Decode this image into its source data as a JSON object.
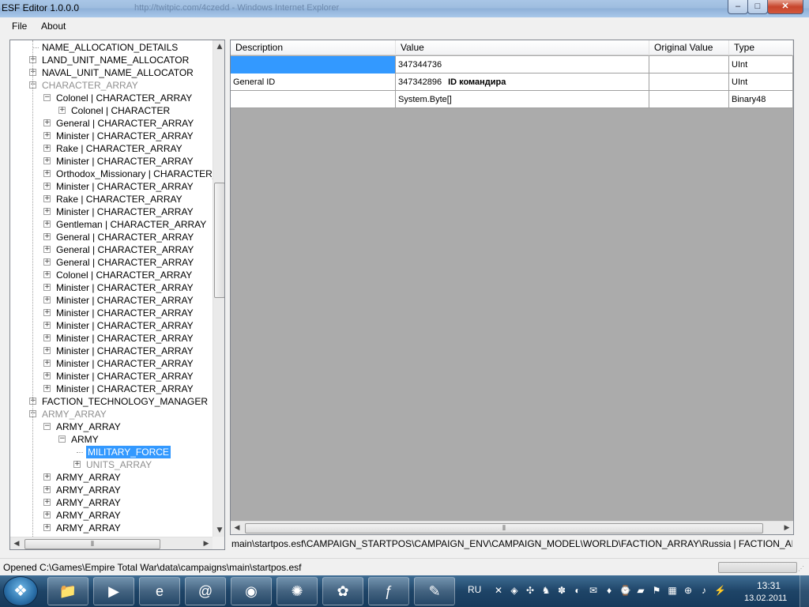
{
  "window": {
    "title": "ESF Editor 1.0.0.0",
    "ghost_title": "http://twitpic.com/4czedd - Windows Internet Explorer",
    "caption_buttons": {
      "minimize": "–",
      "maximize": "□",
      "close": "✕"
    }
  },
  "menu": {
    "file": "File",
    "about": "About"
  },
  "tree": {
    "nodes": [
      {
        "label": "NAME_ALLOCATION_DETAILS",
        "level": 0,
        "expander": "none",
        "gray": false
      },
      {
        "label": "LAND_UNIT_NAME_ALLOCATOR",
        "level": 0,
        "expander": "plus",
        "gray": false
      },
      {
        "label": "NAVAL_UNIT_NAME_ALLOCATOR",
        "level": 0,
        "expander": "plus",
        "gray": false
      },
      {
        "label": "CHARACTER_ARRAY",
        "level": 0,
        "expander": "minus",
        "gray": true
      },
      {
        "label": "Colonel | CHARACTER_ARRAY",
        "level": 1,
        "expander": "minus",
        "gray": false
      },
      {
        "label": "Colonel | CHARACTER",
        "level": 2,
        "expander": "plus",
        "gray": false
      },
      {
        "label": "General | CHARACTER_ARRAY",
        "level": 1,
        "expander": "plus",
        "gray": false
      },
      {
        "label": "Minister | CHARACTER_ARRAY",
        "level": 1,
        "expander": "plus",
        "gray": false
      },
      {
        "label": "Rake | CHARACTER_ARRAY",
        "level": 1,
        "expander": "plus",
        "gray": false
      },
      {
        "label": "Minister | CHARACTER_ARRAY",
        "level": 1,
        "expander": "plus",
        "gray": false
      },
      {
        "label": "Orthodox_Missionary | CHARACTER_ARR",
        "level": 1,
        "expander": "plus",
        "gray": false
      },
      {
        "label": "Minister | CHARACTER_ARRAY",
        "level": 1,
        "expander": "plus",
        "gray": false
      },
      {
        "label": "Rake | CHARACTER_ARRAY",
        "level": 1,
        "expander": "plus",
        "gray": false
      },
      {
        "label": "Minister | CHARACTER_ARRAY",
        "level": 1,
        "expander": "plus",
        "gray": false
      },
      {
        "label": "Gentleman | CHARACTER_ARRAY",
        "level": 1,
        "expander": "plus",
        "gray": false
      },
      {
        "label": "General | CHARACTER_ARRAY",
        "level": 1,
        "expander": "plus",
        "gray": false
      },
      {
        "label": "General | CHARACTER_ARRAY",
        "level": 1,
        "expander": "plus",
        "gray": false
      },
      {
        "label": "General | CHARACTER_ARRAY",
        "level": 1,
        "expander": "plus",
        "gray": false
      },
      {
        "label": "Colonel | CHARACTER_ARRAY",
        "level": 1,
        "expander": "plus",
        "gray": false
      },
      {
        "label": "Minister | CHARACTER_ARRAY",
        "level": 1,
        "expander": "plus",
        "gray": false
      },
      {
        "label": "Minister | CHARACTER_ARRAY",
        "level": 1,
        "expander": "plus",
        "gray": false
      },
      {
        "label": "Minister | CHARACTER_ARRAY",
        "level": 1,
        "expander": "plus",
        "gray": false
      },
      {
        "label": "Minister | CHARACTER_ARRAY",
        "level": 1,
        "expander": "plus",
        "gray": false
      },
      {
        "label": "Minister | CHARACTER_ARRAY",
        "level": 1,
        "expander": "plus",
        "gray": false
      },
      {
        "label": "Minister | CHARACTER_ARRAY",
        "level": 1,
        "expander": "plus",
        "gray": false
      },
      {
        "label": "Minister | CHARACTER_ARRAY",
        "level": 1,
        "expander": "plus",
        "gray": false
      },
      {
        "label": "Minister | CHARACTER_ARRAY",
        "level": 1,
        "expander": "plus",
        "gray": false
      },
      {
        "label": "Minister | CHARACTER_ARRAY",
        "level": 1,
        "expander": "plus",
        "gray": false
      },
      {
        "label": "FACTION_TECHNOLOGY_MANAGER",
        "level": 0,
        "expander": "plus",
        "gray": false
      },
      {
        "label": "ARMY_ARRAY",
        "level": 0,
        "expander": "minus",
        "gray": true
      },
      {
        "label": "ARMY_ARRAY",
        "level": 1,
        "expander": "minus",
        "gray": false
      },
      {
        "label": "ARMY",
        "level": 2,
        "expander": "minus",
        "gray": false
      },
      {
        "label": "MILITARY_FORCE",
        "level": 3,
        "expander": "none",
        "gray": false,
        "selected": true
      },
      {
        "label": "UNITS_ARRAY",
        "level": 3,
        "expander": "plus",
        "gray": true
      },
      {
        "label": "ARMY_ARRAY",
        "level": 1,
        "expander": "plus",
        "gray": false
      },
      {
        "label": "ARMY_ARRAY",
        "level": 1,
        "expander": "plus",
        "gray": false
      },
      {
        "label": "ARMY_ARRAY",
        "level": 1,
        "expander": "plus",
        "gray": false
      },
      {
        "label": "ARMY_ARRAY",
        "level": 1,
        "expander": "plus",
        "gray": false
      },
      {
        "label": "ARMY_ARRAY",
        "level": 1,
        "expander": "plus",
        "gray": false
      }
    ]
  },
  "grid": {
    "columns": [
      "Description",
      "Value",
      "Original Value",
      "Type"
    ],
    "rows": [
      {
        "description": "",
        "value": "347344736",
        "annotation": "",
        "original": "",
        "type": "UInt",
        "selected_description": true
      },
      {
        "description": "General ID",
        "value": "347342896",
        "annotation": "ID командира",
        "original": "",
        "type": "UInt",
        "selected_description": false
      },
      {
        "description": "",
        "value": "System.Byte[]",
        "annotation": "",
        "original": "",
        "type": "Binary48",
        "selected_description": false
      }
    ]
  },
  "path": "main\\startpos.esf\\CAMPAIGN_STARTPOS\\CAMPAIGN_ENV\\CAMPAIGN_MODEL\\WORLD\\FACTION_ARRAY\\Russia | FACTION_ARRAY\\Russia",
  "status": {
    "text": "Opened C:\\Games\\Empire Total War\\data\\campaigns\\main\\startpos.esf"
  },
  "taskbar": {
    "start_glyph": "❖",
    "apps": [
      {
        "name": "explorer",
        "glyph": "📁"
      },
      {
        "name": "media-player",
        "glyph": "▶"
      },
      {
        "name": "internet-explorer",
        "glyph": "e"
      },
      {
        "name": "mail",
        "glyph": "@"
      },
      {
        "name": "firefox",
        "glyph": "◉"
      },
      {
        "name": "safari",
        "glyph": "✺"
      },
      {
        "name": "icq",
        "glyph": "✿"
      },
      {
        "name": "flash-editor",
        "glyph": "ƒ"
      },
      {
        "name": "paint",
        "glyph": "✎"
      }
    ],
    "language": "RU",
    "tray_glyphs": [
      "✕",
      "◈",
      "✣",
      "♞",
      "✽",
      "◐",
      "✉",
      "♦",
      "⌚",
      "▰",
      "⚑",
      "▦",
      "⊕",
      "♪",
      "⚡"
    ],
    "time": "13:31",
    "date": "13.02.2011"
  },
  "colors": {
    "selection": "#3399ff",
    "grid_empty": "#ababab",
    "taskbar": "#1e4467"
  }
}
